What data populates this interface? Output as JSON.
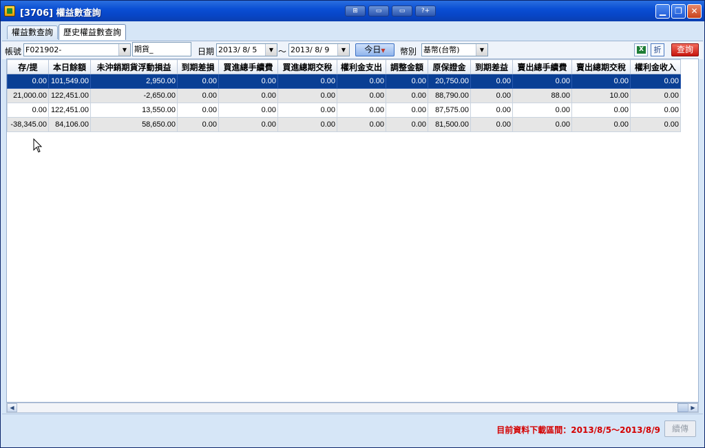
{
  "window": {
    "title": "[3706] 權益數查詢",
    "center_buttons": [
      "⊞",
      "▭",
      "▭",
      "?+"
    ]
  },
  "tabs": [
    {
      "label": "權益數查詢",
      "active": false
    },
    {
      "label": "歷史權益數查詢",
      "active": true
    }
  ],
  "toolbar": {
    "account_label": "帳號",
    "account_value": "F021902-",
    "product_value": "期貨_",
    "date_label": "日期",
    "date_from": "2013/ 8/ 5",
    "tilde": "～",
    "date_to": "2013/ 8/ 9",
    "today_label": "今日",
    "currency_label": "幣別",
    "currency_value": "基幣(台幣)",
    "fold_label": "折",
    "query_label": "查詢"
  },
  "grid": {
    "columns": [
      "存/提",
      "本日餘額",
      "未沖銷期貨浮動損益",
      "到期差損",
      "買進總手續費",
      "買進總期交稅",
      "權利金支出",
      "調整金額",
      "原保證金",
      "到期差益",
      "賣出總手續費",
      "賣出總期交稅",
      "權利金收入"
    ],
    "rows": [
      [
        "0.00",
        "101,549.00",
        "2,950.00",
        "0.00",
        "0.00",
        "0.00",
        "0.00",
        "0.00",
        "20,750.00",
        "0.00",
        "0.00",
        "0.00",
        "0.00"
      ],
      [
        "21,000.00",
        "122,451.00",
        "-2,650.00",
        "0.00",
        "0.00",
        "0.00",
        "0.00",
        "0.00",
        "88,790.00",
        "0.00",
        "88.00",
        "10.00",
        "0.00"
      ],
      [
        "0.00",
        "122,451.00",
        "13,550.00",
        "0.00",
        "0.00",
        "0.00",
        "0.00",
        "0.00",
        "87,575.00",
        "0.00",
        "0.00",
        "0.00",
        "0.00"
      ],
      [
        "-38,345.00",
        "84,106.00",
        "58,650.00",
        "0.00",
        "0.00",
        "0.00",
        "0.00",
        "0.00",
        "81,500.00",
        "0.00",
        "0.00",
        "0.00",
        "0.00"
      ]
    ]
  },
  "status": {
    "download_range": "目前資料下載區間：2013/8/5～2013/8/9",
    "resume_label": "續傳"
  },
  "colors": {
    "title_bar": "#0a4fd4",
    "selected_row": "#0a3f94",
    "alt_row": "#e6e6e6",
    "status_text": "#d40000",
    "query_button": "#c8160d"
  }
}
